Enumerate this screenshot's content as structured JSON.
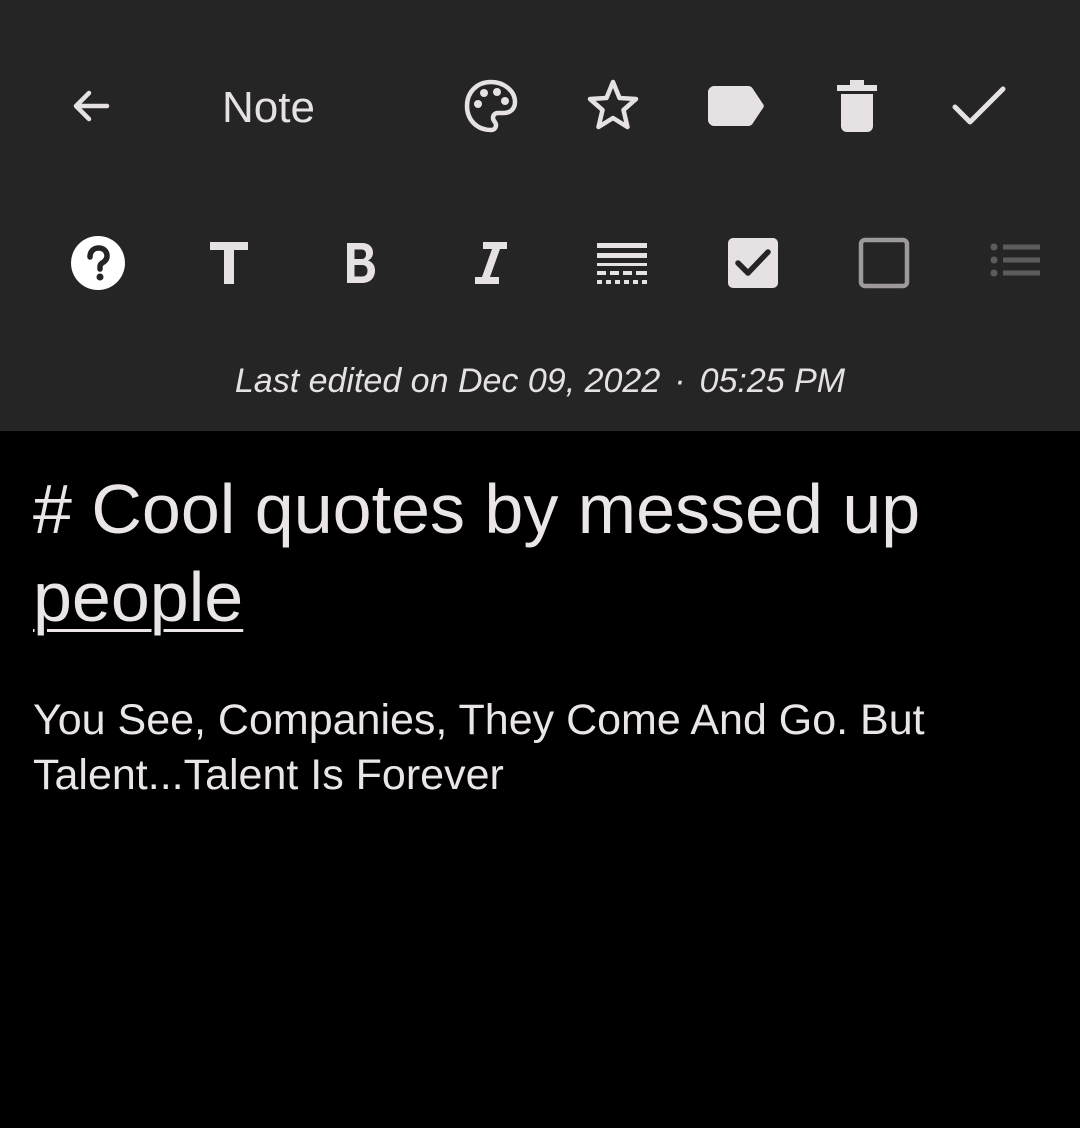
{
  "toolbar": {
    "title": "Note",
    "icons": [
      "arrow-back-icon",
      "palette-icon",
      "star-icon",
      "label-icon",
      "trash-icon",
      "check-icon"
    ]
  },
  "format_bar": {
    "icons": [
      "help-icon",
      "text-format-icon",
      "bold-icon",
      "italic-icon",
      "strikethrough-icon",
      "checkbox-checked-icon",
      "checkbox-unchecked-icon",
      "bulleted-list-icon"
    ]
  },
  "meta": {
    "last_edited_prefix": "Last edited on",
    "date": "Dec 09, 2022",
    "separator": "·",
    "time": "05:25 PM"
  },
  "note": {
    "heading_main": "# Cool quotes by messed up",
    "heading_link": "people",
    "body": "You See, Companies, They Come And Go. But Talent...Talent Is Forever"
  },
  "colors": {
    "header_bg": "#252526",
    "content_bg": "#000000",
    "text": "#e6e1e3"
  }
}
